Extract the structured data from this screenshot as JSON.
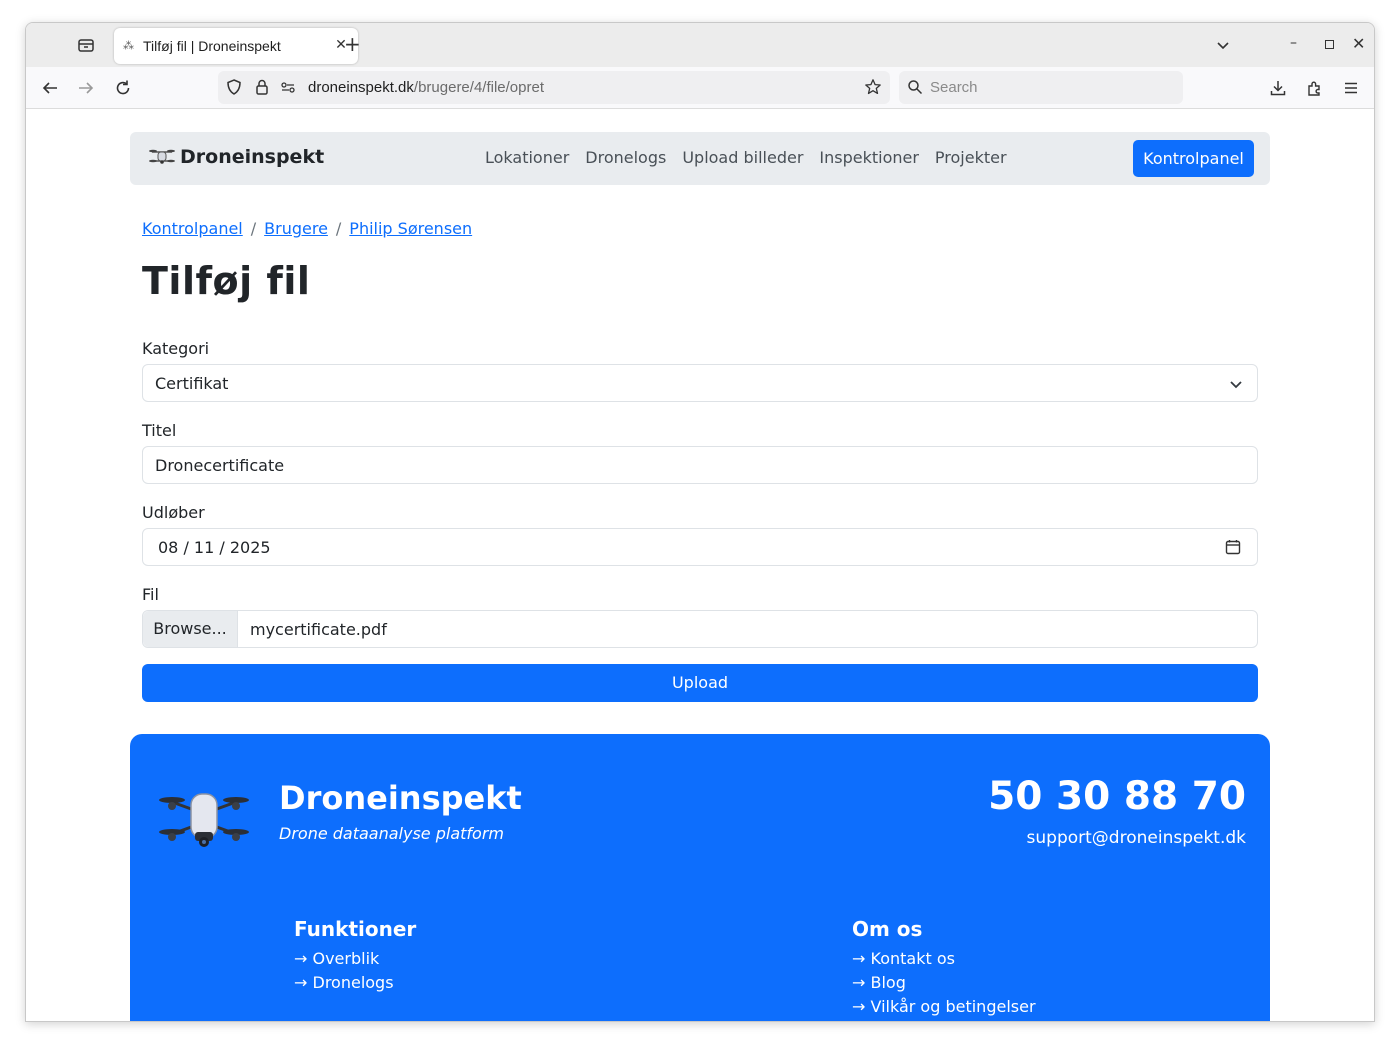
{
  "browser": {
    "tab_title": "Tilføj fil | Droneinspekt",
    "url_host": "droneinspekt.dk",
    "url_path": "/brugere/4/file/opret",
    "search_placeholder": "Search"
  },
  "site": {
    "brand": "Droneinspekt",
    "nav": [
      "Lokationer",
      "Dronelogs",
      "Upload billeder",
      "Inspektioner",
      "Projekter"
    ],
    "cta": "Kontrolpanel"
  },
  "breadcrumb": [
    "Kontrolpanel",
    "Brugere",
    "Philip Sørensen"
  ],
  "breadcrumb_sep": "/",
  "title": "Tilføj fil",
  "form": {
    "category_label": "Kategori",
    "category_value": "Certifikat",
    "title_label": "Titel",
    "title_value": "Dronecertificate",
    "expires_label": "Udløber",
    "expires_value": "08 / 11 / 2025",
    "file_label": "Fil",
    "browse_label": "Browse...",
    "file_name": "mycertificate.pdf",
    "submit_label": "Upload"
  },
  "footer": {
    "brand": "Droneinspekt",
    "tagline": "Drone dataanalyse platform",
    "phone": "50 30 88 70",
    "email": "support@droneinspekt.dk",
    "col1_heading": "Funktioner",
    "col1_links": [
      "→ Overblik",
      "→ Dronelogs"
    ],
    "col2_heading": "Om os",
    "col2_links": [
      "→ Kontakt os",
      "→ Blog",
      "→ Vilkår og betingelser"
    ]
  },
  "colors": {
    "primary": "#0d6efd",
    "navbar_bg": "#e9ecef",
    "text": "#212529"
  }
}
